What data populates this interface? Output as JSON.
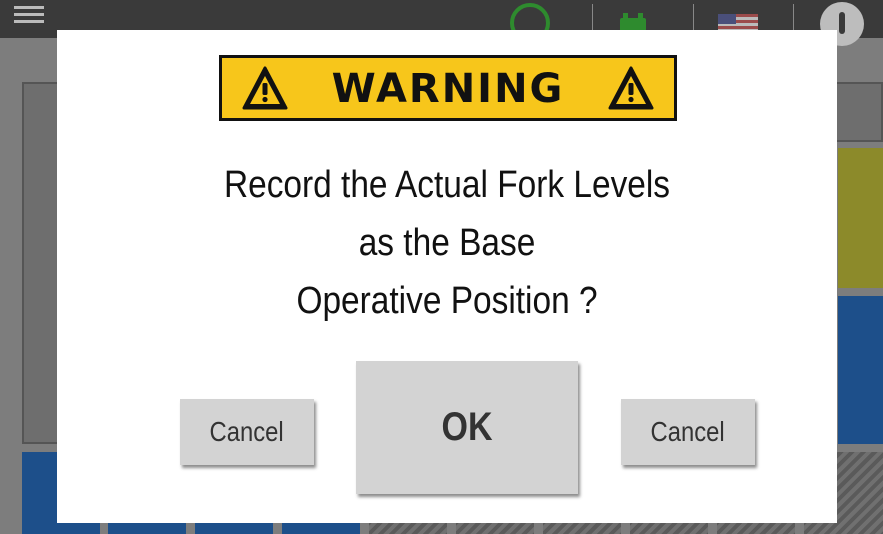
{
  "dialog": {
    "banner": {
      "label": "WARNING",
      "background_color": "#f7c61b",
      "icon": "warning-triangle-icon"
    },
    "message_lines": [
      "Record the Actual Fork Levels",
      "as the Base",
      "Operative Position ?"
    ],
    "buttons": {
      "cancel_left": "Cancel",
      "ok": "OK",
      "cancel_right": "Cancel"
    }
  },
  "background_app": {
    "topbar_icons": [
      "menu-icon",
      "status-ring-icon",
      "battery-icon",
      "flag-icon",
      "info-icon"
    ],
    "accent_colors": {
      "blue": "#1d4f8a",
      "yellow": "#8c8a2a",
      "green": "#2e8b2e"
    }
  }
}
